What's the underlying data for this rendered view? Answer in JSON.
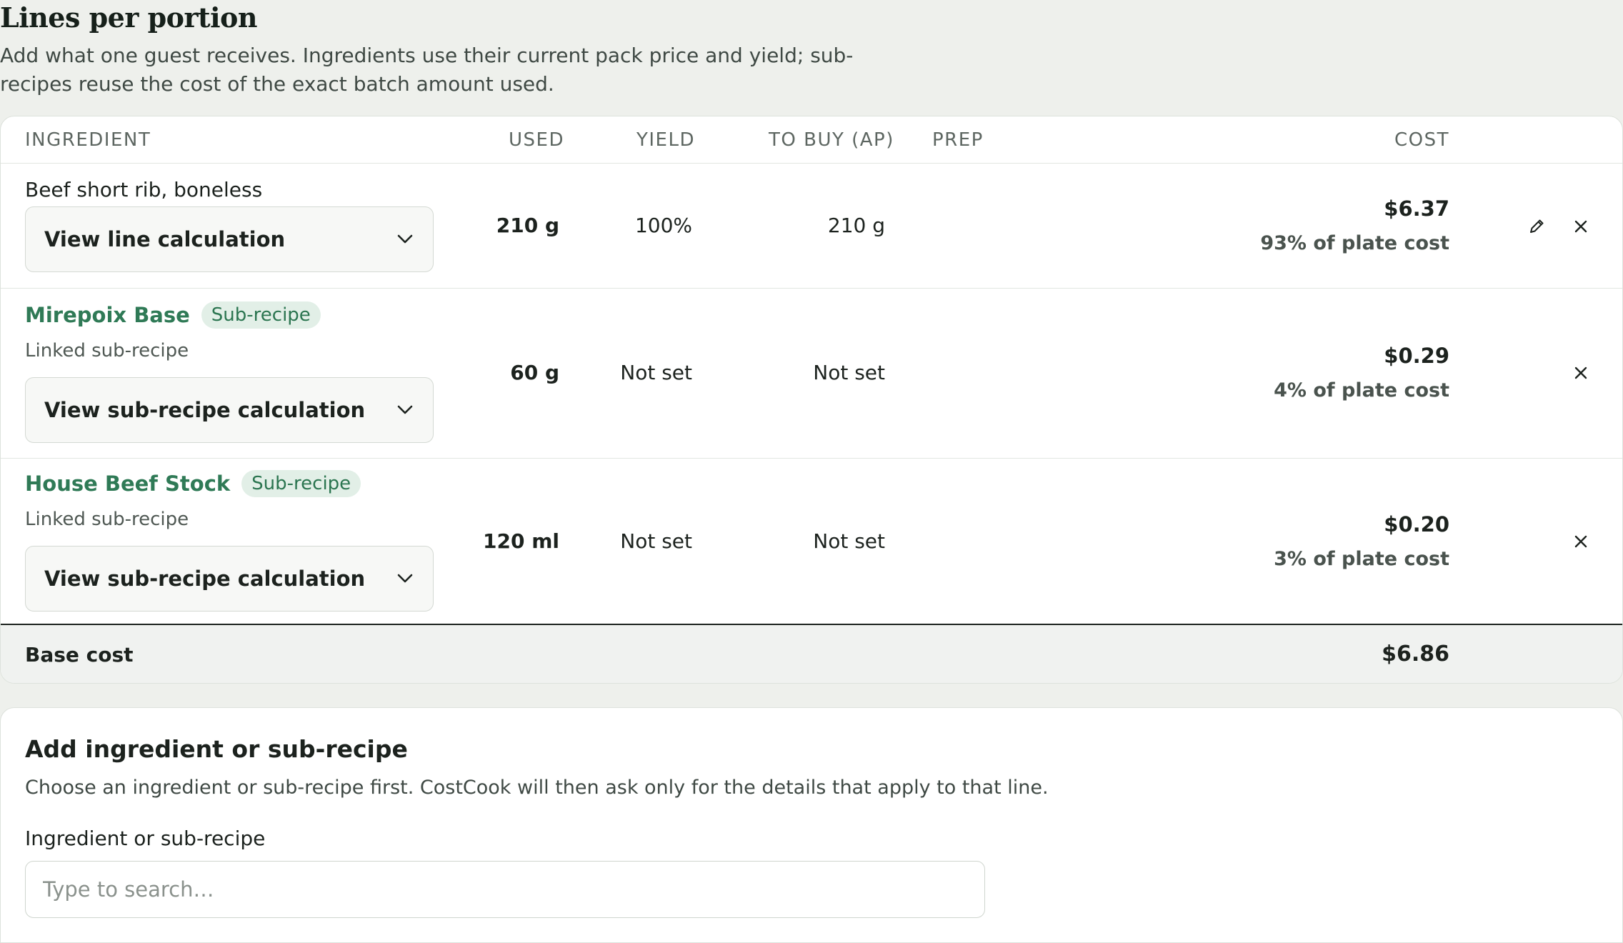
{
  "section": {
    "title": "Lines per portion",
    "description": "Add what one guest receives. Ingredients use their current pack price and yield; sub-recipes reuse the cost of the exact batch amount used."
  },
  "table": {
    "headers": {
      "ingredient": "INGREDIENT",
      "used": "USED",
      "yield": "YIELD",
      "to_buy": "TO BUY (AP)",
      "prep": "PREP",
      "cost": "COST"
    },
    "rows": [
      {
        "name": "Beef short rib, boneless",
        "calc_label": "View line calculation",
        "used": "210 g",
        "yield": "100%",
        "to_buy": "210 g",
        "cost": "$6.37",
        "share": "93% of plate cost"
      },
      {
        "name": "Mirepoix Base",
        "badge": "Sub-recipe",
        "linked": "Linked sub-recipe",
        "calc_label": "View sub-recipe calculation",
        "used": "60 g",
        "yield": "Not set",
        "to_buy": "Not set",
        "cost": "$0.29",
        "share": "4% of plate cost"
      },
      {
        "name": "House Beef Stock",
        "badge": "Sub-recipe",
        "linked": "Linked sub-recipe",
        "calc_label": "View sub-recipe calculation",
        "used": "120 ml",
        "yield": "Not set",
        "to_buy": "Not set",
        "cost": "$0.20",
        "share": "3% of plate cost"
      }
    ],
    "total": {
      "label": "Base cost",
      "value": "$6.86"
    }
  },
  "add": {
    "title": "Add ingredient or sub-recipe",
    "description": "Choose an ingredient or sub-recipe first. CostCook will then ask only for the details that apply to that line.",
    "field_label": "Ingredient or sub-recipe",
    "placeholder": "Type to search…",
    "value": ""
  },
  "icons": {
    "dropdown": "chevron-down-icon",
    "edit": "pencil-icon",
    "remove": "close-icon"
  },
  "colors": {
    "accent_green": "#2f7a56",
    "badge_bg": "#e2efe7",
    "page_bg": "#eef0ec"
  }
}
